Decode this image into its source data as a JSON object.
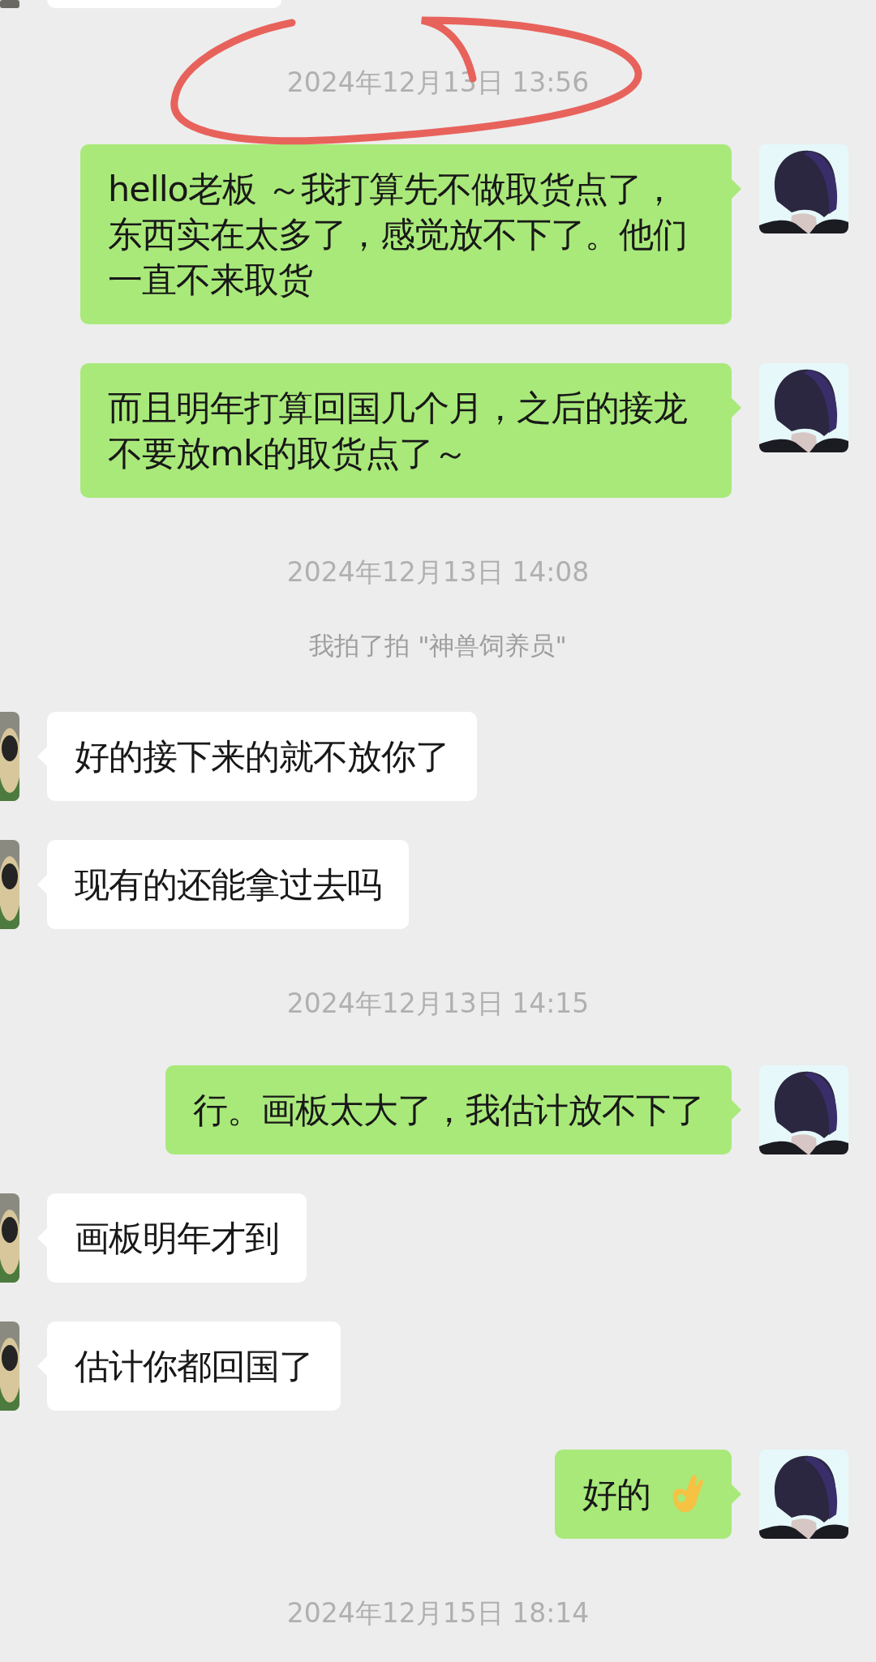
{
  "chat": [
    {
      "kind": "cut_message"
    },
    {
      "kind": "timestamp",
      "text": "2024年12月13日 13:56",
      "annotated": true
    },
    {
      "kind": "message",
      "from_me": true,
      "text": "hello老板 ～我打算先不做取货点了，东西实在太多了，感觉放不下了。他们一直不来取货"
    },
    {
      "kind": "message",
      "from_me": true,
      "text": "而且明年打算回国几个月，之后的接龙不要放mk的取货点了～"
    },
    {
      "kind": "timestamp",
      "text": "2024年12月13日 14:08"
    },
    {
      "kind": "system",
      "text": "我拍了拍 \"神兽饲养员\""
    },
    {
      "kind": "message",
      "from_me": false,
      "text": "好的接下来的就不放你了"
    },
    {
      "kind": "message",
      "from_me": false,
      "text": "现有的还能拿过去吗"
    },
    {
      "kind": "timestamp",
      "text": "2024年12月13日 14:15"
    },
    {
      "kind": "message",
      "from_me": true,
      "text": "行。画板太大了，我估计放不下了"
    },
    {
      "kind": "message",
      "from_me": false,
      "text": "画板明年才到"
    },
    {
      "kind": "message",
      "from_me": false,
      "text": "估计你都回国了"
    },
    {
      "kind": "emoji_message",
      "from_me": true,
      "text": "好的"
    },
    {
      "kind": "timestamp",
      "text": "2024年12月15日 18:14"
    }
  ]
}
